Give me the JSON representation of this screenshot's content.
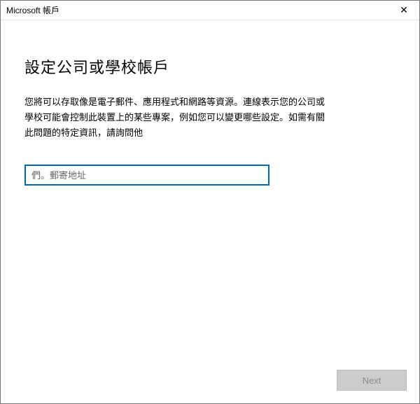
{
  "titlebar": {
    "title": "Microsoft 帳戶",
    "close_icon": "✕"
  },
  "main": {
    "heading": "設定公司或學校帳戶",
    "description": "您將可以存取像是電子郵件、應用程式和網路等資源。連線表示您的公司或學校可能會控制此裝置上的某些專案，例如您可以變更哪些設定。如需有關此問題的特定資訊，請詢問他",
    "email_placeholder": "們。郵寄地址",
    "email_value": ""
  },
  "footer": {
    "next_label": "Next"
  }
}
